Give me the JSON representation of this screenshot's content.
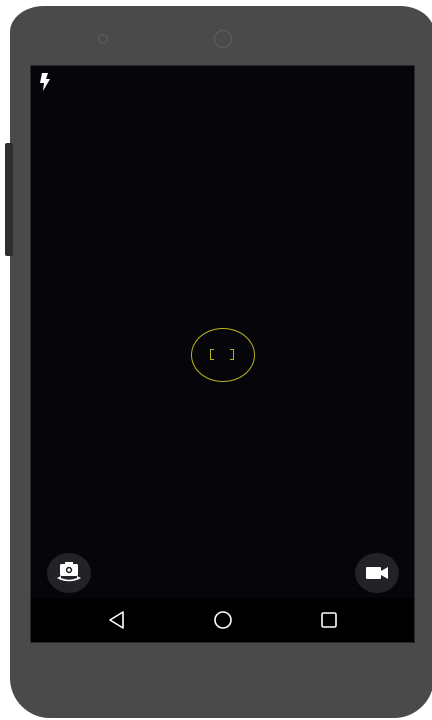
{
  "device": {
    "frame_color": "#4a4a4a",
    "screen_color": "#07060b"
  },
  "camera": {
    "flash_icon": "flash-icon",
    "focus_ring_color": "#b7b320",
    "switch_camera_icon": "switch-camera-icon",
    "video_icon": "video-camera-icon"
  },
  "nav": {
    "back_icon": "back-triangle-icon",
    "home_icon": "home-circle-icon",
    "recents_icon": "recents-square-icon"
  }
}
